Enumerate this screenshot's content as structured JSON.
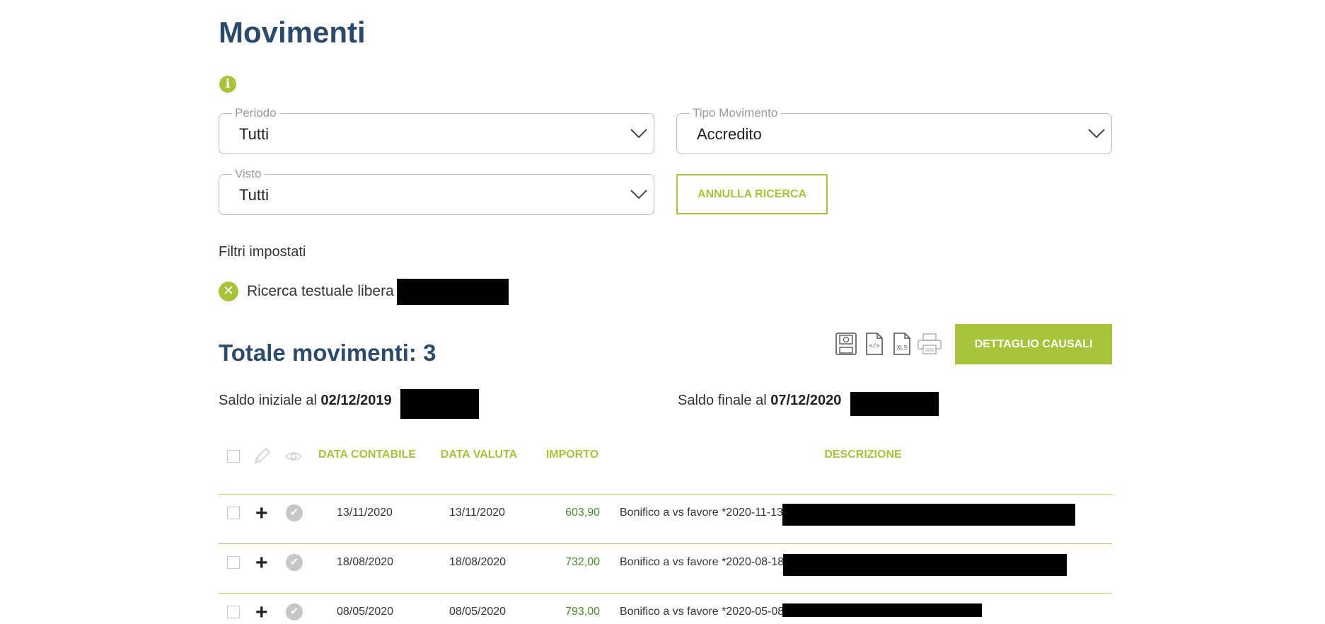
{
  "page": {
    "title": "Movimenti"
  },
  "filters": {
    "periodo": {
      "label": "Periodo",
      "value": "Tutti"
    },
    "tipo_movimento": {
      "label": "Tipo Movimento",
      "value": "Accredito"
    },
    "visto": {
      "label": "Visto",
      "value": "Tutti"
    },
    "reset_button": "ANNULLA RICERCA",
    "applied_label": "Filtri impostati",
    "applied": [
      {
        "label": "Ricerca testuale libera"
      }
    ]
  },
  "summary": {
    "total_label": "Totale movimenti: 3",
    "detail_button": "DETTAGLIO CAUSALI",
    "export_xls_label": "XLS",
    "saldo_iniziale_label": "Saldo iniziale al",
    "saldo_iniziale_date": "02/12/2019",
    "saldo_finale_label": "Saldo finale al",
    "saldo_finale_date": "07/12/2020"
  },
  "table": {
    "headers": {
      "data_contabile": "DATA CONTABILE",
      "data_valuta": "DATA VALUTA",
      "importo": "IMPORTO",
      "descrizione": "DESCRIZIONE"
    },
    "rows": [
      {
        "data_contabile": "13/11/2020",
        "data_valuta": "13/11/2020",
        "importo": "603,90",
        "descrizione": "Bonifico a vs favore *2020-11-13*"
      },
      {
        "data_contabile": "18/08/2020",
        "data_valuta": "18/08/2020",
        "importo": "732,00",
        "descrizione": "Bonifico a vs favore *2020-08-18*"
      },
      {
        "data_contabile": "08/05/2020",
        "data_valuta": "08/05/2020",
        "importo": "793,00",
        "descrizione": "Bonifico a vs favore *2020-05-08*"
      }
    ]
  },
  "icons": {
    "info": "info-icon",
    "filter_remove": "close-circle-icon",
    "export": [
      "save-icon",
      "code-file-icon",
      "xls-file-icon",
      "printer-icon"
    ],
    "header": [
      "checkbox-icon",
      "pencil-icon",
      "eye-icon"
    ],
    "row": [
      "plus-icon",
      "check-circle-icon"
    ]
  },
  "colors": {
    "accent": "#a6c339",
    "title": "#2c4a6b",
    "amount": "#4a8e2b"
  }
}
